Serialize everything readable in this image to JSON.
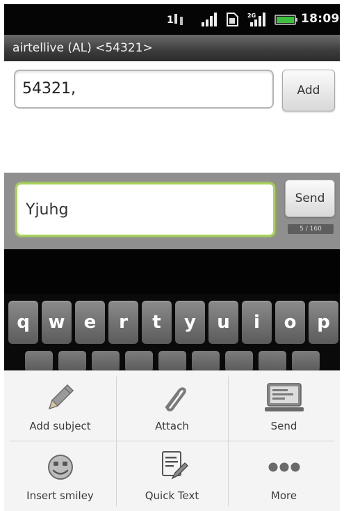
{
  "status_bar": {
    "time": "18:09",
    "icons": [
      "data-transfer-icon",
      "signal-icon",
      "sd-card-icon",
      "signal-edge-icon",
      "battery-icon"
    ]
  },
  "title_bar": {
    "title": "airtellive (AL) <54321>"
  },
  "recipient": {
    "value": "54321,",
    "add_label": "Add"
  },
  "compose": {
    "message": "Yjuhg",
    "send_label": "Send",
    "counter": "5 / 160"
  },
  "keyboard": {
    "row1": [
      "q",
      "w",
      "e",
      "r",
      "t",
      "y",
      "u",
      "i",
      "o",
      "p"
    ]
  },
  "menu": {
    "items": [
      {
        "label": "Add subject",
        "icon": "pencil-icon"
      },
      {
        "label": "Attach",
        "icon": "paperclip-icon"
      },
      {
        "label": "Send",
        "icon": "send-message-icon"
      },
      {
        "label": "Insert smiley",
        "icon": "smiley-icon"
      },
      {
        "label": "Quick Text",
        "icon": "quick-text-icon"
      },
      {
        "label": "More",
        "icon": "more-icon"
      }
    ]
  },
  "colors": {
    "accent_green": "#a9d25a",
    "status_bar": "#050505",
    "compose_bg": "#8f8f8f"
  }
}
